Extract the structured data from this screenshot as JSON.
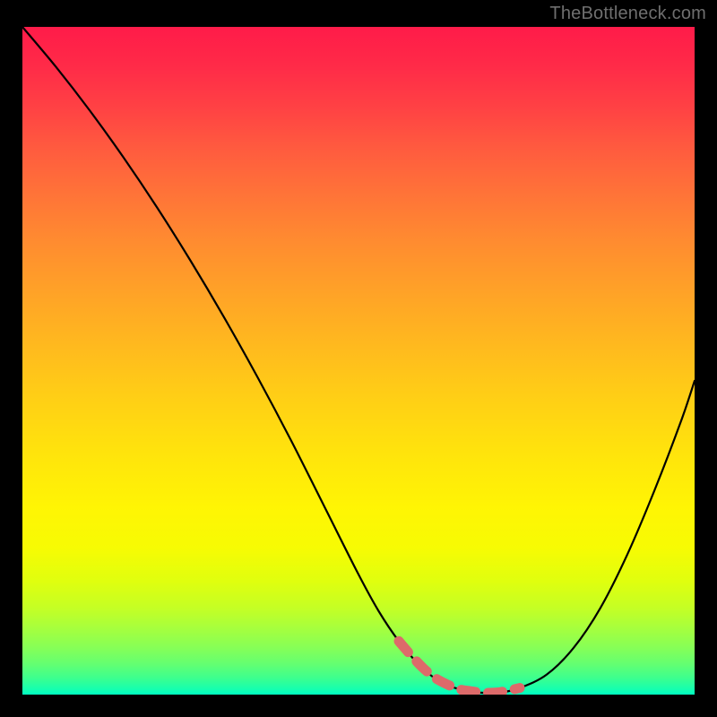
{
  "watermark": "TheBottleneck.com",
  "chart_data": {
    "type": "line",
    "title": "",
    "xlabel": "",
    "ylabel": "",
    "xlim": [
      0,
      100
    ],
    "ylim": [
      0,
      100
    ],
    "series": [
      {
        "name": "curve",
        "x": [
          0,
          5,
          10,
          15,
          20,
          25,
          30,
          35,
          40,
          45,
          50,
          53,
          56,
          59,
          62,
          65,
          68,
          71,
          74,
          78,
          82,
          86,
          90,
          94,
          98,
          100
        ],
        "values": [
          100,
          94,
          87.5,
          80.5,
          73,
          65,
          56.5,
          47.5,
          38,
          28,
          18,
          12.5,
          8,
          4.5,
          2,
          0.8,
          0.3,
          0.3,
          1,
          3,
          7,
          13,
          21,
          30.5,
          41,
          47
        ]
      }
    ],
    "marker_region": {
      "x": [
        56,
        74
      ],
      "values": [
        8,
        1
      ],
      "color": "#dd6a6a"
    },
    "gradient_colors": {
      "top": "#ff1b49",
      "mid": "#ffe40c",
      "bottom": "#00ffc2"
    }
  }
}
